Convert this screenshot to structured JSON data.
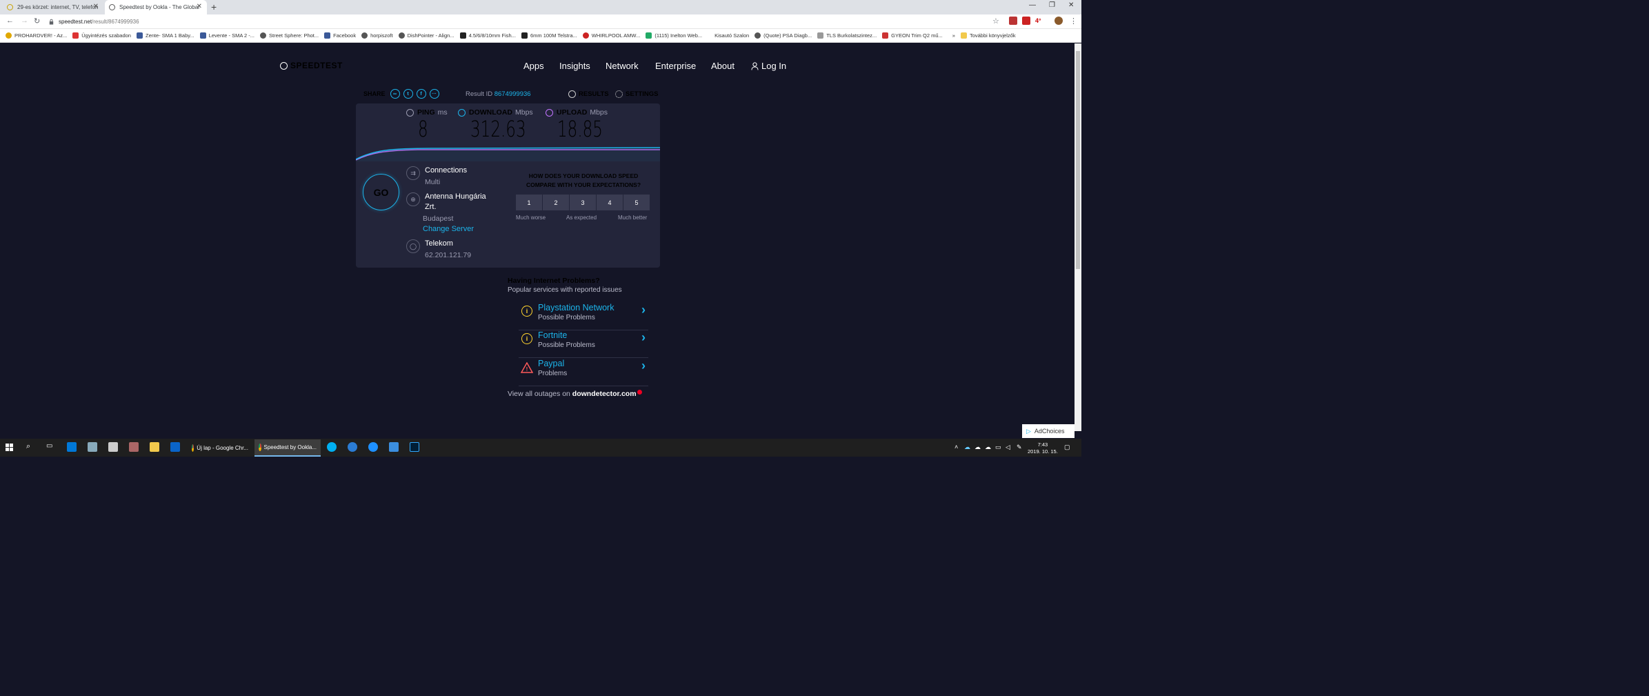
{
  "browser": {
    "tabs": [
      {
        "title": "29-es körzet: internet, TV, telefon"
      },
      {
        "title": "Speedtest by Ookla - The Global"
      }
    ],
    "url_host": "speedtest.net",
    "url_path": "/result/8674999936",
    "bookmarks": [
      "PROHARDVER! - Az...",
      "Ügyintézés szabadon",
      "Zente- SMA 1 Baby...",
      "Levente - SMA 2 -...",
      "Street Sphere: Phot...",
      "Facebook",
      "horpiszoft",
      "DishPointer - Align...",
      "4.5/6/8/10mm Fish...",
      "6mm 100M Telstra...",
      "WHIRLPOOL AMW...",
      "(1115) Inelton Web...",
      "Kisautó Szalon",
      "(Quote) PSA Diagb...",
      "TLS Burkolatszintez...",
      "GYEON Trim Q2 mű..."
    ],
    "bookmarks_more": "»",
    "bookmarks_other": "További könyvjelzők",
    "ext_temp": "4°"
  },
  "site": {
    "logo": "SPEEDTEST",
    "nav": [
      "Apps",
      "Insights",
      "Network",
      "Enterprise",
      "About",
      "Log In"
    ],
    "share_label": "SHARE",
    "result_id_label": "Result ID",
    "result_id": "8674999936",
    "results_label": "RESULTS",
    "settings_label": "SETTINGS"
  },
  "metrics": {
    "ping": {
      "label": "PING",
      "unit": "ms",
      "value": "8"
    },
    "download": {
      "label": "DOWNLOAD",
      "unit": "Mbps",
      "value": "312.63"
    },
    "upload": {
      "label": "UPLOAD",
      "unit": "Mbps",
      "value": "18.85"
    }
  },
  "go_label": "GO",
  "connection": {
    "connections_label": "Connections",
    "connections_value": "Multi",
    "server_name_line1": "Antenna Hungária",
    "server_name_line2": "Zrt.",
    "server_city": "Budapest",
    "change_server": "Change Server",
    "isp": "Telekom",
    "ip": "62.201.121.79"
  },
  "survey": {
    "question": "HOW DOES YOUR DOWNLOAD SPEED COMPARE WITH YOUR EXPECTATIONS?",
    "options": [
      "1",
      "2",
      "3",
      "4",
      "5"
    ],
    "labels": [
      "Much worse",
      "As expected",
      "Much better"
    ]
  },
  "problems": {
    "heading": "Having Internet Problems?",
    "subheading": "Popular services with reported issues",
    "items": [
      {
        "name": "Playstation Network",
        "status": "Possible Problems",
        "icon": "info-icon"
      },
      {
        "name": "Fortnite",
        "status": "Possible Problems",
        "icon": "info-icon"
      },
      {
        "name": "Paypal",
        "status": "Problems",
        "icon": "warning-icon"
      }
    ],
    "footer_prefix": "View all outages on",
    "footer_link": "downdetector.com"
  },
  "adchoices": "AdChoices",
  "taskbar": {
    "apps": [
      {
        "title": "Új lap - Google Chr..."
      },
      {
        "title": "Speedtest by Ookla..."
      }
    ],
    "time": "7:43",
    "date": "2019. 10. 15."
  },
  "colors": {
    "accent": "#1cb4ea",
    "background": "#141526",
    "card": "#23253a",
    "upload": "#c273ff",
    "warning": "#ffd42e",
    "danger": "#ff5a5a"
  }
}
